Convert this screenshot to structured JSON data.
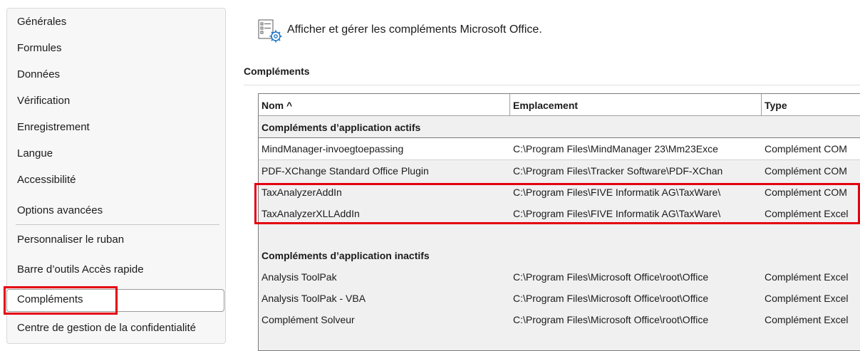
{
  "sidebar": {
    "items": [
      {
        "label": "Générales"
      },
      {
        "label": "Formules"
      },
      {
        "label": "Données"
      },
      {
        "label": "Vérification"
      },
      {
        "label": "Enregistrement"
      },
      {
        "label": "Langue"
      },
      {
        "label": "Accessibilité"
      },
      {
        "label": "Options avancées"
      },
      {
        "label": "Personnaliser le ruban"
      },
      {
        "label": "Barre d’outils Accès rapide"
      },
      {
        "label": "Compléments"
      },
      {
        "label": "Centre de gestion de la confidentialité"
      }
    ],
    "selected_index": 10
  },
  "header": {
    "icon": "addins-settings-icon",
    "text": "Afficher et gérer les compléments Microsoft Office."
  },
  "section": {
    "title": "Compléments"
  },
  "table": {
    "columns": [
      "Nom ^",
      "Emplacement",
      "Type"
    ],
    "active_group": "Compléments d’application actifs",
    "active_rows": [
      {
        "name": "MindManager-invoegtoepassing",
        "location": "C:\\Program Files\\MindManager 23\\Mm23Exce",
        "type": "Complément COM"
      },
      {
        "name": "PDF-XChange Standard Office Plugin",
        "location": "C:\\Program Files\\Tracker Software\\PDF-XChan",
        "type": "Complément COM"
      },
      {
        "name": "TaxAnalyzerAddIn",
        "location": "C:\\Program Files\\FIVE Informatik AG\\TaxWare\\",
        "type": "Complément COM"
      },
      {
        "name": "TaxAnalyzerXLLAddIn",
        "location": "C:\\Program Files\\FIVE Informatik AG\\TaxWare\\",
        "type": "Complément Excel"
      }
    ],
    "inactive_group": "Compléments d’application inactifs",
    "inactive_rows": [
      {
        "name": "Analysis ToolPak",
        "location": "C:\\Program Files\\Microsoft Office\\root\\Office",
        "type": "Complément Excel"
      },
      {
        "name": "Analysis ToolPak - VBA",
        "location": "C:\\Program Files\\Microsoft Office\\root\\Office",
        "type": "Complément Excel"
      },
      {
        "name": "Complément Solveur",
        "location": "C:\\Program Files\\Microsoft Office\\root\\Office",
        "type": "Complément Excel"
      }
    ]
  },
  "colors": {
    "highlight_red": "#e4000f",
    "table_bg": "#f0f0f0",
    "selected_row_bg": "#ffffff"
  }
}
